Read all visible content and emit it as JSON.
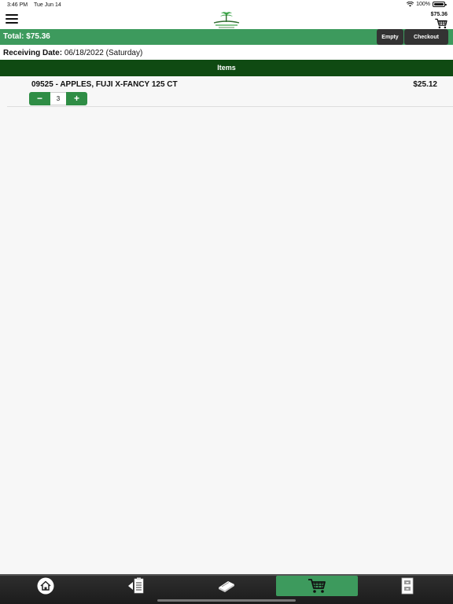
{
  "status": {
    "time": "3:46 PM",
    "date": "Tue Jun 14",
    "battery": "100%"
  },
  "header": {
    "cart_total": "$75.36"
  },
  "total_bar": {
    "label": "Total:",
    "amount": "$75.36",
    "empty_label": "Empty",
    "checkout_label": "Checkout"
  },
  "receiving": {
    "label": "Receiving Date:",
    "value": "06/18/2022 (Saturday)"
  },
  "items_header": "Items",
  "items": [
    {
      "name": "09525 - APPLES, FUJI X-FANCY 125 CT",
      "price": "$25.12",
      "quantity": "3",
      "minus": "−",
      "plus": "+"
    }
  ],
  "tabs": [
    {
      "icon": "home-icon"
    },
    {
      "icon": "orders-icon"
    },
    {
      "icon": "catalog-icon"
    },
    {
      "icon": "cart-icon",
      "active": true
    },
    {
      "icon": "account-icon"
    }
  ],
  "colors": {
    "accent": "#3d9a5d",
    "header_dark": "#0f4a12",
    "button_dark": "#333333",
    "stepper": "#2f8d45"
  }
}
